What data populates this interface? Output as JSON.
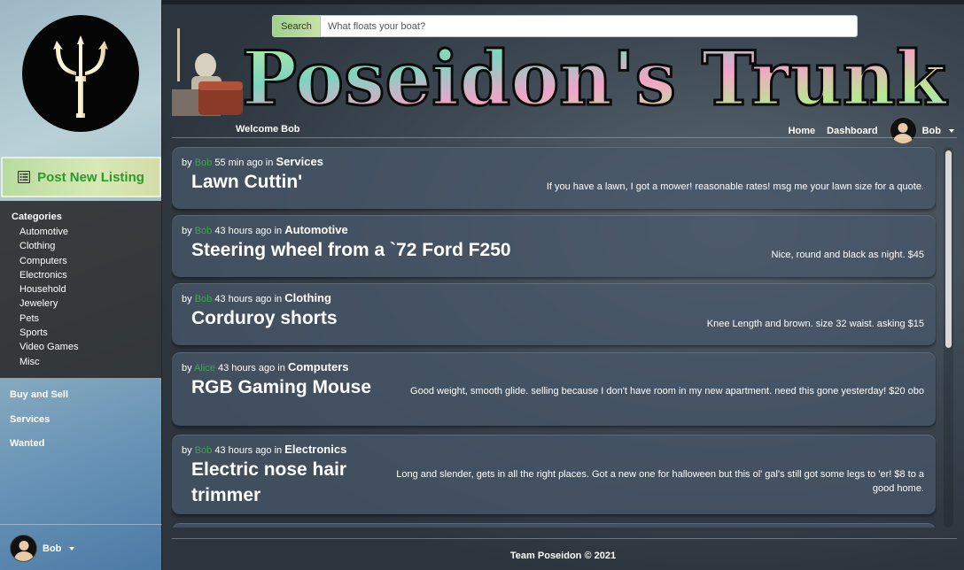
{
  "sidebar": {
    "post_listing_label": "Post New Listing",
    "categories_title": "Categories",
    "categories": [
      "Automotive",
      "Clothing",
      "Computers",
      "Electronics",
      "Household",
      "Jewelery",
      "Pets",
      "Sports",
      "Video Games",
      "Misc"
    ],
    "links": [
      "Buy and Sell",
      "Services",
      "Wanted"
    ],
    "user_name": "Bob"
  },
  "header": {
    "search_button": "Search",
    "search_placeholder": "What floats your boat?",
    "banner_title": "Poseidon's Trunk",
    "welcome": "Welcome Bob",
    "nav_home": "Home",
    "nav_dashboard": "Dashboard",
    "nav_user": "Bob"
  },
  "listings": [
    {
      "by": "by",
      "author": "Bob",
      "time": "55 min ago in",
      "category": "Services",
      "title": "Lawn Cuttin'",
      "description": "If you have a lawn, I got a mower! reasonable rates! msg me your lawn size for a quote."
    },
    {
      "by": "by",
      "author": "Bob",
      "time": "43 hours ago in",
      "category": "Automotive",
      "title": "Steering wheel from a `72 Ford F250",
      "description": "Nice, round and black as night. $45"
    },
    {
      "by": "by",
      "author": "Bob",
      "time": "43 hours ago in",
      "category": "Clothing",
      "title": "Corduroy shorts",
      "description": "Knee Length and brown. size 32 waist. asking $15"
    },
    {
      "by": "by",
      "author": "Alice",
      "time": "43 hours ago in",
      "category": "Computers",
      "title": "RGB Gaming Mouse",
      "description": "Good weight, smooth glide. selling because I don't have room in my new apartment. need this gone yesterday! $20 obo"
    },
    {
      "by": "by",
      "author": "Bob",
      "time": "43 hours ago in",
      "category": "Electronics",
      "title": "Electric nose hair trimmer",
      "description": "Long and slender, gets in all the right places. Got a new one for halloween but this ol' gal's still got some legs to 'er! $8 to a good home."
    }
  ],
  "footer": {
    "text": "Team Poseidon © 2021"
  },
  "colors": {
    "author": "#3aa84a",
    "post_button_text": "#2a9a2a"
  },
  "icons": {
    "logo": "trident-icon",
    "post": "list-icon",
    "avatar": "user-avatar-icon"
  }
}
